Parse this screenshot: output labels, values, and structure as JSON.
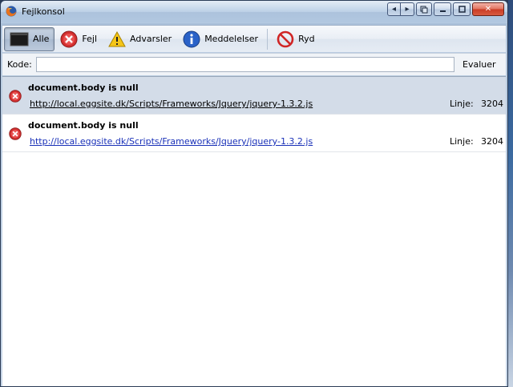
{
  "window": {
    "title": "Fejlkonsol"
  },
  "toolbar": {
    "items": [
      {
        "label": "Alle",
        "icon": "console-all-icon",
        "active": true
      },
      {
        "label": "Fejl",
        "icon": "error-icon"
      },
      {
        "label": "Advarsler",
        "icon": "warning-icon"
      },
      {
        "label": "Meddelelser",
        "icon": "info-icon"
      },
      {
        "label": "Ryd",
        "icon": "clear-icon"
      }
    ]
  },
  "command": {
    "label": "Kode:",
    "value": "",
    "evaluate_label": "Evaluer"
  },
  "entries": [
    {
      "message": "document.body is null",
      "source": "http://local.eggsite.dk/Scripts/Frameworks/Jquery/jquery-1.3.2.js",
      "line_label": "Linje:",
      "line": "3204",
      "selected": true
    },
    {
      "message": "document.body is null",
      "source": "http://local.eggsite.dk/Scripts/Frameworks/Jquery/jquery-1.3.2.js",
      "line_label": "Linje:",
      "line": "3204",
      "selected": false
    }
  ],
  "colors": {
    "error_red": "#d32f2f",
    "link_blue": "#1a31b8",
    "selected_row": "#d3dce8"
  }
}
